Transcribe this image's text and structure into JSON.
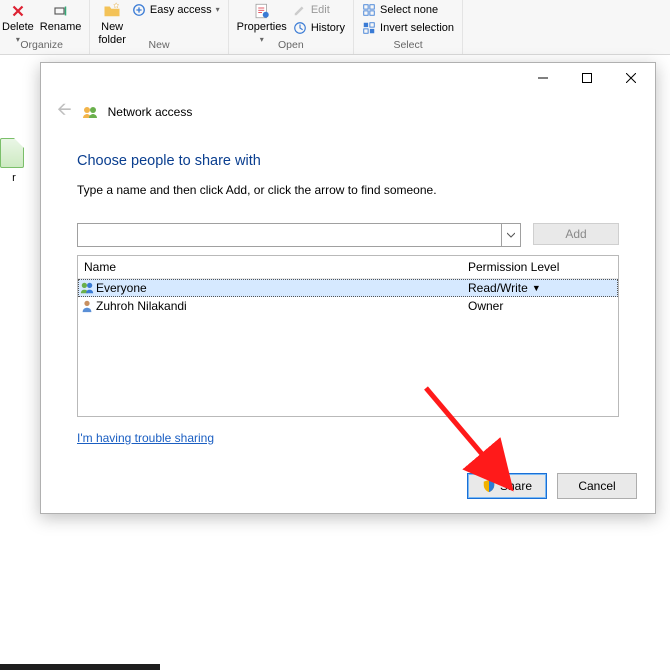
{
  "ribbon": {
    "organize": {
      "delete": "Delete",
      "rename": "Rename",
      "label": "Organize"
    },
    "new": {
      "newfolder_a": "New",
      "newfolder_b": "folder",
      "easy": "Easy access",
      "label": "New"
    },
    "open": {
      "properties": "Properties",
      "edit": "Edit",
      "history": "History",
      "label": "Open"
    },
    "select": {
      "none": "Select none",
      "invert": "Invert selection",
      "label": "Select"
    }
  },
  "tree": {
    "item": "r"
  },
  "dialog": {
    "title": "Network access",
    "heading": "Choose people to share with",
    "instruction": "Type a name and then click Add, or click the arrow to find someone.",
    "add_label": "Add",
    "columns": {
      "name": "Name",
      "perm": "Permission Level"
    },
    "rows": [
      {
        "name": "Everyone",
        "perm": "Read/Write",
        "selected": true,
        "dropdown": true,
        "icon": "group"
      },
      {
        "name": "Zuhroh Nilakandi",
        "perm": "Owner",
        "selected": false,
        "dropdown": false,
        "icon": "user"
      }
    ],
    "trouble": "I'm having trouble sharing",
    "share": "Share",
    "cancel": "Cancel"
  }
}
